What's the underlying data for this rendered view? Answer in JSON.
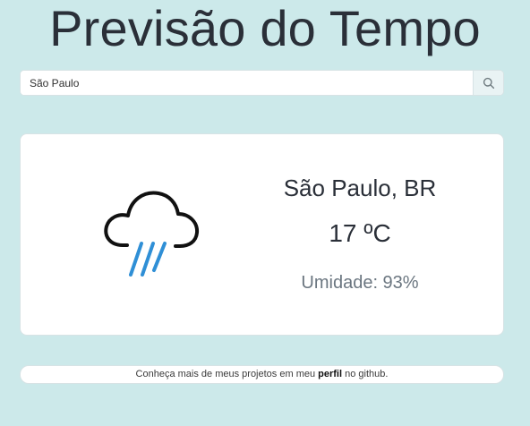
{
  "page": {
    "title": "Previsão do Tempo"
  },
  "search": {
    "value": "São Paulo",
    "icon": "search-icon"
  },
  "weather": {
    "city": "São Paulo, BR",
    "temperature": "17 ºC",
    "humidity": "Umidade: 93%",
    "icon": "rain-cloud-icon"
  },
  "footer": {
    "text_before": "Conheça mais de meus projetos em meu ",
    "link_label": "perfil",
    "text_after": " no github."
  },
  "colors": {
    "background": "#cce9ea",
    "card": "#ffffff",
    "text": "#2a2f38",
    "muted_text": "#6b7680",
    "rain": "#2f8fd6"
  }
}
